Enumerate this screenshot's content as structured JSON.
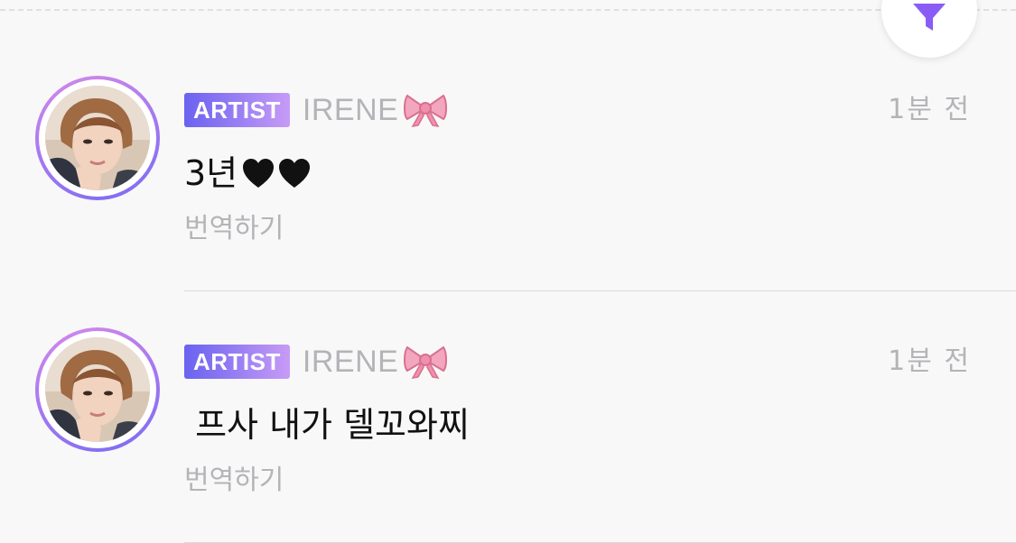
{
  "filter": {
    "icon": "filter-icon",
    "accent": "#8a5cf6"
  },
  "posts": [
    {
      "badge": "ARTIST",
      "author": "IRENE",
      "author_emoji": "ribbon-icon",
      "time": "1분 전",
      "message": "3년",
      "message_emoji": [
        "black-heart-icon",
        "black-heart-icon"
      ],
      "translate": "번역하기"
    },
    {
      "badge": "ARTIST",
      "author": "IRENE",
      "author_emoji": "ribbon-icon",
      "time": "1분 전",
      "message": " 프사 내가 델꼬와찌",
      "translate": "번역하기"
    }
  ],
  "colors": {
    "badge_start": "#6a62f0",
    "badge_end": "#c79bf6",
    "muted_text": "#b4b4b8",
    "background": "#f8f8f8"
  }
}
